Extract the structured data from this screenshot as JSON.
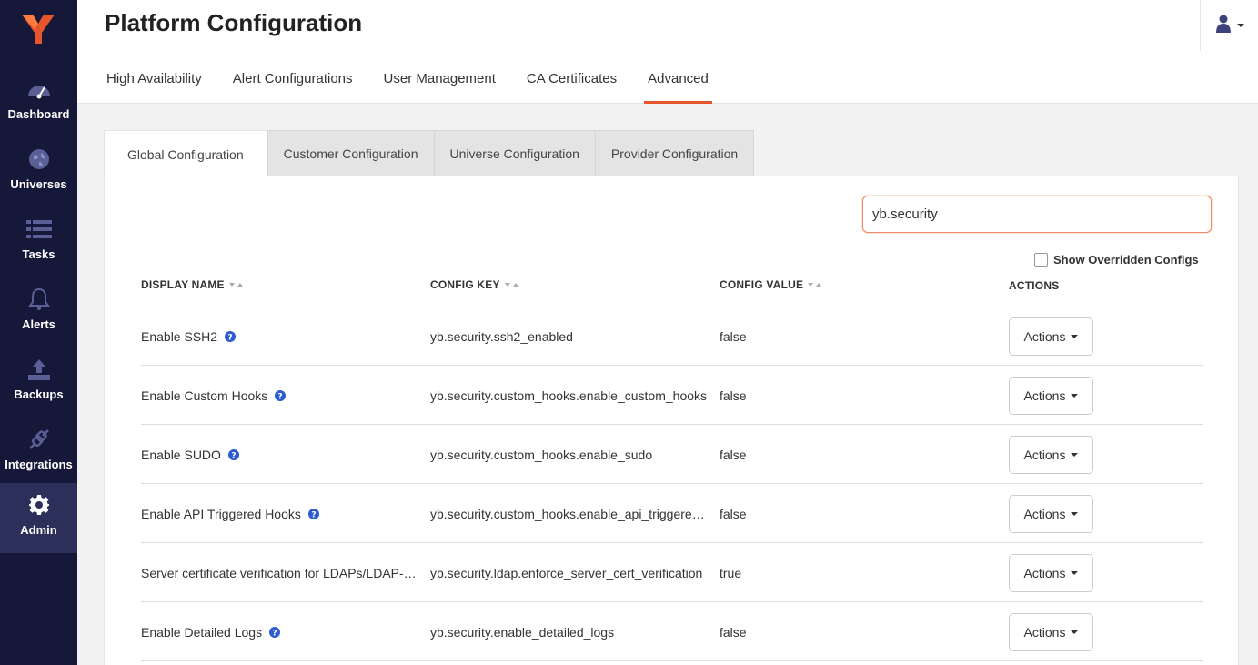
{
  "sidebar": {
    "items": [
      {
        "label": "Dashboard",
        "icon": "dashboard-gauge-icon"
      },
      {
        "label": "Universes",
        "icon": "globe-icon"
      },
      {
        "label": "Tasks",
        "icon": "list-icon"
      },
      {
        "label": "Alerts",
        "icon": "bell-icon"
      },
      {
        "label": "Backups",
        "icon": "upload-icon"
      },
      {
        "label": "Integrations",
        "icon": "plug-icon"
      },
      {
        "label": "Admin",
        "icon": "gear-icon",
        "active": true
      }
    ]
  },
  "header": {
    "title": "Platform Configuration",
    "tabs": [
      {
        "label": "High Availability"
      },
      {
        "label": "Alert Configurations"
      },
      {
        "label": "User Management"
      },
      {
        "label": "CA Certificates"
      },
      {
        "label": "Advanced",
        "active": true
      }
    ]
  },
  "sub_tabs": [
    {
      "label": "Global Configuration",
      "active": true
    },
    {
      "label": "Customer Configuration"
    },
    {
      "label": "Universe Configuration"
    },
    {
      "label": "Provider Configuration"
    }
  ],
  "search": {
    "value": "yb.security"
  },
  "show_overridden": {
    "label": "Show Overridden Configs",
    "checked": false
  },
  "table": {
    "columns": [
      "DISPLAY NAME",
      "CONFIG KEY",
      "CONFIG VALUE",
      "ACTIONS"
    ],
    "rows": [
      {
        "name": "Enable SSH2",
        "key": "yb.security.ssh2_enabled",
        "value": "false",
        "help": true,
        "action": "Actions"
      },
      {
        "name": "Enable Custom Hooks",
        "key": "yb.security.custom_hooks.enable_custom_hooks",
        "value": "false",
        "help": true,
        "action": "Actions"
      },
      {
        "name": "Enable SUDO",
        "key": "yb.security.custom_hooks.enable_sudo",
        "value": "false",
        "help": true,
        "action": "Actions"
      },
      {
        "name": "Enable API Triggered Hooks",
        "key": "yb.security.custom_hooks.enable_api_triggered_hooks",
        "value": "false",
        "help": true,
        "action": "Actions"
      },
      {
        "name": "Server certificate verification for LDAPs/LDAP-TLS",
        "key": "yb.security.ldap.enforce_server_cert_verification",
        "value": "true",
        "help": false,
        "action": "Actions"
      },
      {
        "name": "Enable Detailed Logs",
        "key": "yb.security.enable_detailed_logs",
        "value": "false",
        "help": true,
        "action": "Actions"
      }
    ]
  },
  "colors": {
    "sidebar_bg": "#151838",
    "accent": "#e6552b",
    "help_icon": "#2f5bd1",
    "nav_icon": "#3b4072"
  }
}
